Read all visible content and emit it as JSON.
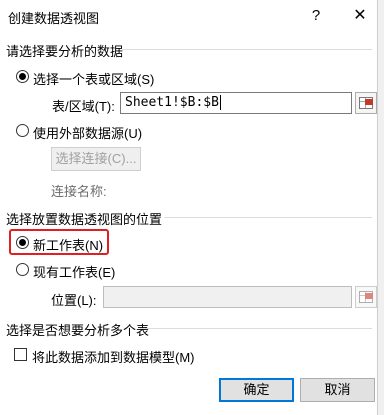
{
  "window": {
    "title": "创建数据透视图",
    "help_label": "?",
    "close_label": "✕"
  },
  "section_data": {
    "heading": "请选择要分析的数据",
    "option_table": "选择一个表或区域(S)",
    "range_label": "表/区域(T):",
    "range_value": "Sheet1!$B:$B",
    "option_external": "使用外部数据源(U)",
    "choose_connection": "选择连接(C)...",
    "connection_name_label": "连接名称:"
  },
  "section_location": {
    "heading": "选择放置数据透视图的位置",
    "option_new": "新工作表(N)",
    "option_existing": "现有工作表(E)",
    "location_label": "位置(L):",
    "location_value": ""
  },
  "section_multi": {
    "heading": "选择是否想要分析多个表",
    "add_to_model": "将此数据添加到数据模型(M)"
  },
  "buttons": {
    "ok": "确定",
    "cancel": "取消"
  },
  "state": {
    "selected_source": "table",
    "selected_location": "new",
    "add_to_model_checked": false
  },
  "colors": {
    "highlight": "#e02020",
    "accent": "#0078d7"
  }
}
